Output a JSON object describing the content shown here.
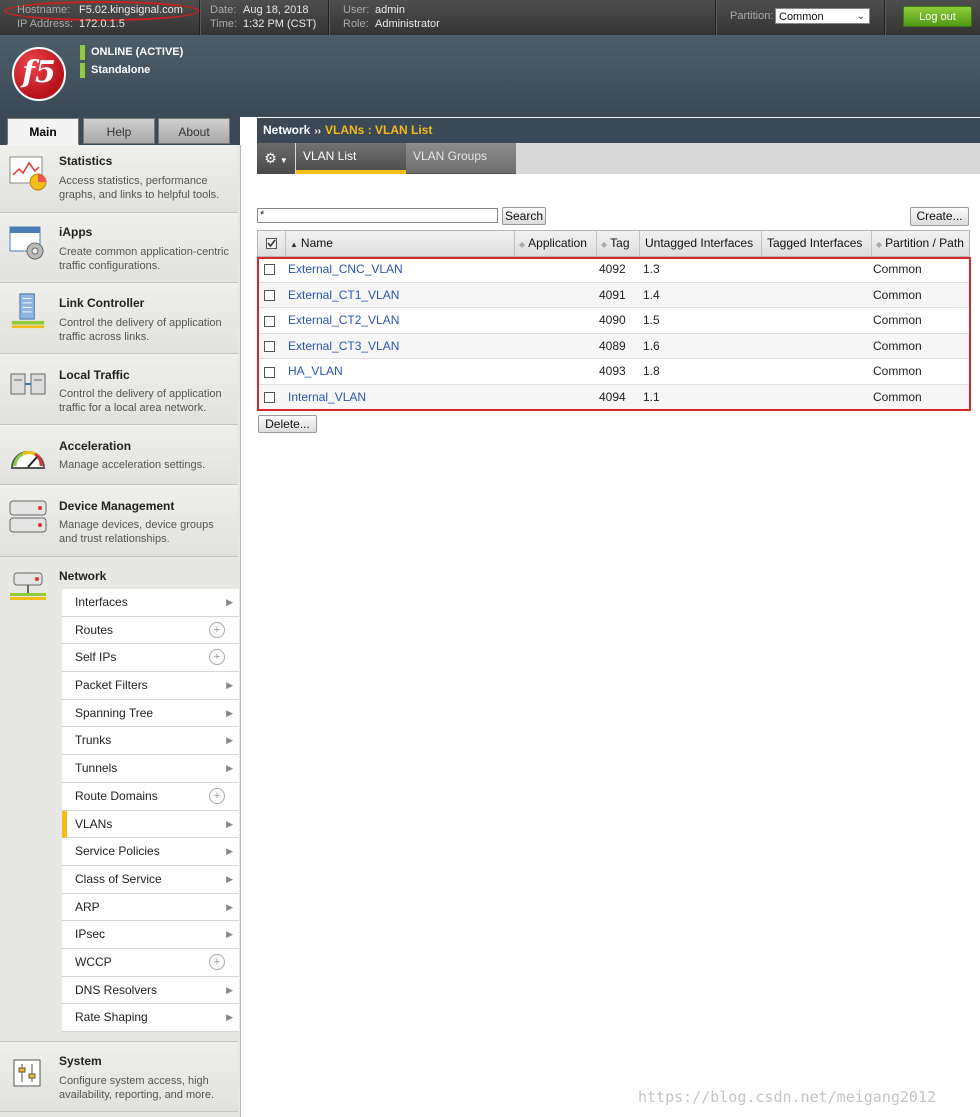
{
  "topbar": {
    "hostname_label": "Hostname:",
    "hostname": "F5.02.kingsignal.com",
    "ip_label": "IP Address:",
    "ip": "172.0.1.5",
    "date_label": "Date:",
    "date": "Aug 18, 2018",
    "time_label": "Time:",
    "time": "1:32 PM (CST)",
    "user_label": "User:",
    "user": "admin",
    "role_label": "Role:",
    "role": "Administrator",
    "partition_label": "Partition:",
    "partition_value": "Common",
    "logout_label": "Log out"
  },
  "header": {
    "logo_text": "f5",
    "status": "ONLINE (ACTIVE)",
    "mode": "Standalone"
  },
  "tabs": [
    "Main",
    "Help",
    "About"
  ],
  "nav_sections": [
    {
      "title": "Statistics",
      "desc": "Access statistics, performance graphs, and links to helpful tools.",
      "icon": "statistics-icon"
    },
    {
      "title": "iApps",
      "desc": "Create common application-centric traffic configurations.",
      "icon": "iapps-icon"
    },
    {
      "title": "Link Controller",
      "desc": "Control the delivery of application traffic across links.",
      "icon": "link-controller-icon"
    },
    {
      "title": "Local Traffic",
      "desc": "Control the delivery of application traffic for a local area network.",
      "icon": "local-traffic-icon"
    },
    {
      "title": "Acceleration",
      "desc": "Manage acceleration settings.",
      "icon": "gauge-icon"
    },
    {
      "title": "Device Management",
      "desc": "Manage devices, device groups and trust relationships.",
      "icon": "device-icon"
    },
    {
      "title": "Network",
      "desc": "",
      "icon": "network-icon"
    },
    {
      "title": "System",
      "desc": "Configure system access, high availability, reporting, and more.",
      "icon": "system-icon"
    }
  ],
  "network_items": [
    {
      "label": "Interfaces",
      "kind": "arrow"
    },
    {
      "label": "Routes",
      "kind": "plus"
    },
    {
      "label": "Self IPs",
      "kind": "plus"
    },
    {
      "label": "Packet Filters",
      "kind": "arrow"
    },
    {
      "label": "Spanning Tree",
      "kind": "arrow"
    },
    {
      "label": "Trunks",
      "kind": "arrow"
    },
    {
      "label": "Tunnels",
      "kind": "arrow"
    },
    {
      "label": "Route Domains",
      "kind": "plus"
    },
    {
      "label": "VLANs",
      "kind": "arrow",
      "selected": true
    },
    {
      "label": "Service Policies",
      "kind": "arrow"
    },
    {
      "label": "Class of Service",
      "kind": "arrow"
    },
    {
      "label": "ARP",
      "kind": "arrow"
    },
    {
      "label": "IPsec",
      "kind": "arrow"
    },
    {
      "label": "WCCP",
      "kind": "plus"
    },
    {
      "label": "DNS Resolvers",
      "kind": "arrow"
    },
    {
      "label": "Rate Shaping",
      "kind": "arrow"
    }
  ],
  "breadcrumb": {
    "section": "Network",
    "separator": "››",
    "current": "VLANs : VLAN List"
  },
  "subtabs": {
    "active": "VLAN List",
    "inactive": "VLAN Groups"
  },
  "search": {
    "value": "*",
    "button": "Search"
  },
  "create_label": "Create...",
  "delete_label": "Delete...",
  "columns": [
    "Name",
    "Application",
    "Tag",
    "Untagged Interfaces",
    "Tagged Interfaces",
    "Partition / Path"
  ],
  "rows": [
    {
      "name": "External_CNC_VLAN",
      "application": "",
      "tag": "4092",
      "untagged": "1.3",
      "tagged": "",
      "partition": "Common"
    },
    {
      "name": "External_CT1_VLAN",
      "application": "",
      "tag": "4091",
      "untagged": "1.4",
      "tagged": "",
      "partition": "Common"
    },
    {
      "name": "External_CT2_VLAN",
      "application": "",
      "tag": "4090",
      "untagged": "1.5",
      "tagged": "",
      "partition": "Common"
    },
    {
      "name": "External_CT3_VLAN",
      "application": "",
      "tag": "4089",
      "untagged": "1.6",
      "tagged": "",
      "partition": "Common"
    },
    {
      "name": "HA_VLAN",
      "application": "",
      "tag": "4093",
      "untagged": "1.8",
      "tagged": "",
      "partition": "Common"
    },
    {
      "name": "Internal_VLAN",
      "application": "",
      "tag": "4094",
      "untagged": "1.1",
      "tagged": "",
      "partition": "Common"
    }
  ],
  "watermark": "https://blog.csdn.net/meigang2012"
}
